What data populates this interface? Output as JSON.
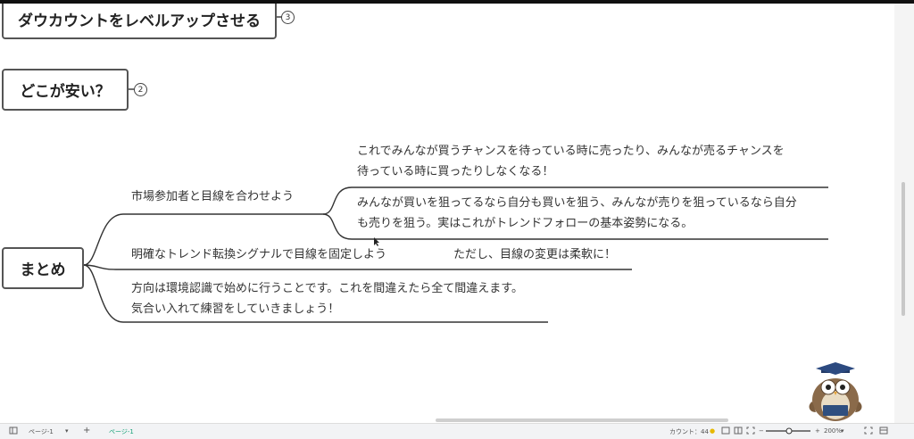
{
  "nodes": {
    "top_partial": "ダウカウントをレベルアップさせる",
    "top_badge": "3",
    "where_cheap": "どこが安い？",
    "where_badge": "2",
    "summary": "まとめ"
  },
  "branches": {
    "align_view": "市場参加者と目線を合わせよう",
    "sub1_line1": "これでみんなが買うチャンスを待っている時に売ったり、みんなが売るチャンスを",
    "sub1_line2": "待っている時に買ったりしなくなる！",
    "sub2_line1": "みんなが買いを狙ってるなら自分も買いを狙う、みんなが売りを狙っているなら自分",
    "sub2_line2": "も売りを狙う。実はこれがトレンドフォローの基本姿勢になる。",
    "signal": "明確なトレンド転換シグナルで目線を固定しよう",
    "flexible": "ただし、目線の変更は柔軟に！",
    "direction_line1": "方向は環境認識で始めに行うことです。これを間違えたら全て間違えます。",
    "direction_line2": "気合い入れて練習をしていきましょう！"
  },
  "statusbar": {
    "page_select": "ページ-1",
    "add": "+",
    "active_tab": "ページ-1",
    "count_label": "カウント：44",
    "zoom": "200%",
    "zoom_minus": "−",
    "zoom_plus": "+"
  },
  "colors": {
    "accent": "#1aa37a",
    "line": "#333333"
  }
}
